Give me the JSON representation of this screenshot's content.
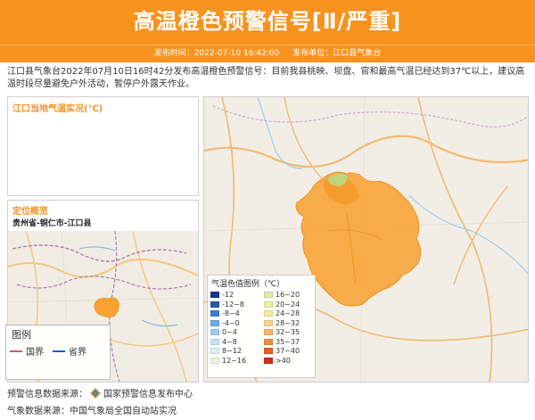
{
  "header": {
    "title": "高温橙色预警信号[Ⅱ/严重]",
    "publish_time": "发布时间：2022-07-10 16:42:00",
    "publisher": "发布单位：江口县气象台"
  },
  "description": "江口县气象台2022年07月10日16时42分发布高温橙色预警信号：目前我县桃映、坝盘、官和最高气温已经达到37℃以上，建议高温时段尽量避免户外活动，暂停户外露天作业。",
  "temp_panel": {
    "title": "江口当地气温实况(℃)"
  },
  "location_panel": {
    "title": "定位概览",
    "region": "贵州省-铜仁市-江口县"
  },
  "small_legend": {
    "title": "图例",
    "items": [
      {
        "label": "国界",
        "color": "#c0607a"
      },
      {
        "label": "省界",
        "color": "#2255cc"
      }
    ]
  },
  "temp_legend": {
    "title": "气温色值图例（℃）",
    "items": [
      {
        "label": "-12",
        "color": "#1a3a8a"
      },
      {
        "label": "16~20",
        "color": "#d6f0b0"
      },
      {
        "label": "-12~8",
        "color": "#2a5aaa"
      },
      {
        "label": "20~24",
        "color": "#e8f49a"
      },
      {
        "label": "-8~4",
        "color": "#3d7fd0"
      },
      {
        "label": "24~28",
        "color": "#fbe8a0"
      },
      {
        "label": "-4~0",
        "color": "#6fa8e4"
      },
      {
        "label": "28~32",
        "color": "#fcd28a"
      },
      {
        "label": "0~4",
        "color": "#9fcaf0"
      },
      {
        "label": "32~35",
        "color": "#f8b46a"
      },
      {
        "label": "4~8",
        "color": "#c4e2f4"
      },
      {
        "label": "35~37",
        "color": "#f48c3c"
      },
      {
        "label": "8~12",
        "color": "#d8f0e8"
      },
      {
        "label": "37~40",
        "color": "#e85a24"
      },
      {
        "label": "12~16",
        "color": "#e6f6dc"
      },
      {
        "label": ">40",
        "color": "#d42a1a"
      }
    ]
  },
  "sources": {
    "warning_source_label": "预警信息数据来源：",
    "warning_source": "国家预警信息发布中心",
    "weather_source_label": "气象数据来源：",
    "weather_source": "中国气象局全国自动站实况"
  },
  "colors": {
    "accent": "#f7931e",
    "county_fill": "#f7a233"
  }
}
